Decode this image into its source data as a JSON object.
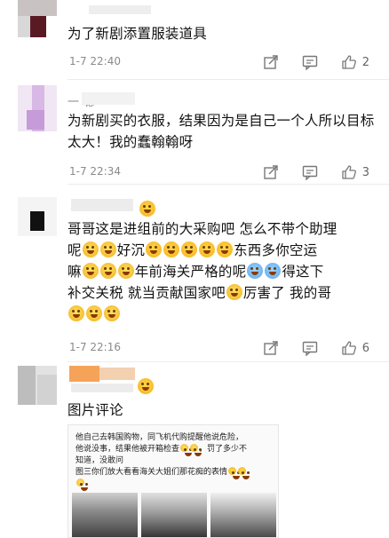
{
  "comments": [
    {
      "username": "",
      "text": "为了新剧添置服装道具",
      "time": "1-7 22:40",
      "likes": "2"
    },
    {
      "username": "一      聪",
      "text": "为新剧买的衣服，结果因为是自己一个人所以目标太大！我的蠢翰翰呀",
      "time": "1-7 22:34",
      "likes": "3"
    },
    {
      "username": "",
      "line1": "哥哥这是进组前的大采购吧 怎么不带个助理",
      "line2a": "呢",
      "line2b": "好沉",
      "line2c": "东西多你空运",
      "line3a": "嘛",
      "line3b": "年前海关严格的呢",
      "line3c": "得这下",
      "line4a": "补交关税 就当贡献国家吧",
      "line4b": "厉害了 我的哥",
      "time": "1-7 22:16",
      "likes": "6"
    },
    {
      "username": "",
      "label": "图片评论",
      "card_line1": "他自己去韩国购物，同飞机代购提醒他说危险，",
      "card_line2": "他说没事，结果他被开箱检查",
      "card_line2b": "，罚了多少不",
      "card_line3": "知道，没敢问",
      "card_line4": "图三你们放大看看海关大姐们那花痴的表情"
    }
  ],
  "icons": {
    "share": "share-icon",
    "comment": "comment-icon",
    "like": "thumb-up-icon"
  },
  "colors": {
    "text": "#111111",
    "meta": "#8a8a8a",
    "icon": "#777777"
  }
}
